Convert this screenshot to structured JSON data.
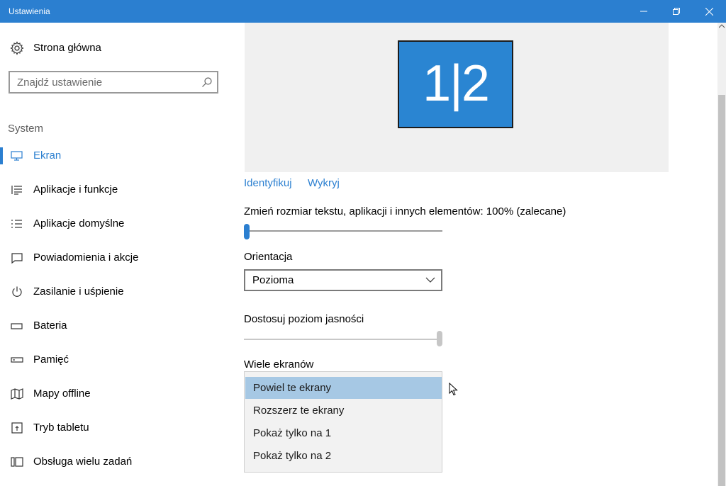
{
  "window": {
    "title": "Ustawienia"
  },
  "sidebar": {
    "home_label": "Strona główna",
    "search_placeholder": "Znajdź ustawienie",
    "section_label": "System",
    "items": [
      {
        "label": "Ekran",
        "icon": "monitor-icon"
      },
      {
        "label": "Aplikacje i funkcje",
        "icon": "list-icon"
      },
      {
        "label": "Aplikacje domyślne",
        "icon": "default-apps-icon"
      },
      {
        "label": "Powiadomienia i akcje",
        "icon": "notification-icon"
      },
      {
        "label": "Zasilanie i uśpienie",
        "icon": "power-icon"
      },
      {
        "label": "Bateria",
        "icon": "battery-icon"
      },
      {
        "label": "Pamięć",
        "icon": "storage-icon"
      },
      {
        "label": "Mapy offline",
        "icon": "map-icon"
      },
      {
        "label": "Tryb tabletu",
        "icon": "tablet-icon"
      },
      {
        "label": "Obsługa wielu zadań",
        "icon": "multitask-icon"
      }
    ]
  },
  "main": {
    "monitor_label": "1|2",
    "identify_link": "Identyfikuj",
    "detect_link": "Wykryj",
    "scale_label": "Zmień rozmiar tekstu, aplikacji i innych elementów: 100% (zalecane)",
    "scale_value_percent": 0,
    "orientation_label": "Orientacja",
    "orientation_value": "Pozioma",
    "brightness_label": "Dostosuj poziom jasności",
    "brightness_value_percent": 100,
    "multi_display_label": "Wiele ekranów",
    "multi_display_options": [
      "Powiel te ekrany",
      "Rozszerz te ekrany",
      "Pokaż tylko na 1",
      "Pokaż tylko na 2"
    ],
    "selected_option": "Powiel te ekrany"
  },
  "colors": {
    "accent": "#2b7fd0",
    "titlebar": "#2b7fd0",
    "monitor": "#2a85d2",
    "selected": "#a6c8e4"
  }
}
